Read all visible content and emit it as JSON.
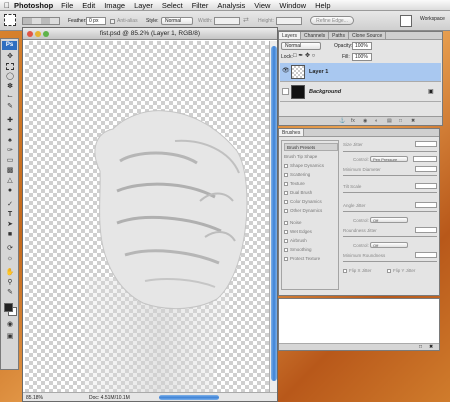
{
  "menubar": {
    "app": "Photoshop",
    "items": [
      "File",
      "Edit",
      "Image",
      "Layer",
      "Select",
      "Filter",
      "Analysis",
      "View",
      "Window",
      "Help"
    ]
  },
  "options": {
    "feather_label": "Feather:",
    "feather_value": "0 px",
    "anti_alias_label": "Anti-alias",
    "style_label": "Style:",
    "style_value": "Normal",
    "width_label": "Width:",
    "height_label": "Height:",
    "refine_edge_label": "Refine Edge...",
    "workspace_label": "Workspace"
  },
  "document": {
    "title": "fist.psd @ 85.2% (Layer 1, RGB/8)",
    "zoom": "85.18%",
    "doc_size": "Doc: 4.51M/10.1M"
  },
  "layers_panel": {
    "tabs": [
      "Layers",
      "Channels",
      "Paths",
      "Clone Source"
    ],
    "blend_mode": "Normal",
    "opacity_label": "Opacity:",
    "opacity_value": "100%",
    "lock_label": "Lock:",
    "fill_label": "Fill:",
    "fill_value": "100%",
    "layers": [
      {
        "name": "Layer 1",
        "selected": true
      },
      {
        "name": "Background",
        "selected": false
      }
    ]
  },
  "brushes_panel": {
    "tab": "Brushes",
    "list": [
      {
        "label": "Brush Presets",
        "kind": "header"
      },
      {
        "label": "Brush Tip Shape",
        "kind": "plain"
      },
      {
        "label": "Shape Dynamics",
        "kind": "check"
      },
      {
        "label": "Scattering",
        "kind": "check"
      },
      {
        "label": "Texture",
        "kind": "check"
      },
      {
        "label": "Dual Brush",
        "kind": "check"
      },
      {
        "label": "Color Dynamics",
        "kind": "check"
      },
      {
        "label": "Other Dynamics",
        "kind": "check"
      },
      {
        "label": "Noise",
        "kind": "check"
      },
      {
        "label": "Wet Edges",
        "kind": "check"
      },
      {
        "label": "Airbrush",
        "kind": "check"
      },
      {
        "label": "Smoothing",
        "kind": "check"
      },
      {
        "label": "Protect Texture",
        "kind": "check"
      }
    ],
    "size_jitter": "Size Jitter",
    "control_label": "Control:",
    "control_pen": "Pen Pressure",
    "minimum_diameter": "Minimum Diameter",
    "tilt_scale": "Tilt Scale",
    "angle_jitter": "Angle Jitter",
    "control_off": "Off",
    "roundness_jitter": "Roundness Jitter",
    "minimum_roundness": "Minimum Roundness",
    "flip_x": "Flip X Jitter",
    "flip_y": "Flip Y Jitter"
  },
  "colors": {
    "accent": "#3d82d6",
    "selected_layer": "#a9c8f0",
    "desktop": "#d07c2c"
  }
}
